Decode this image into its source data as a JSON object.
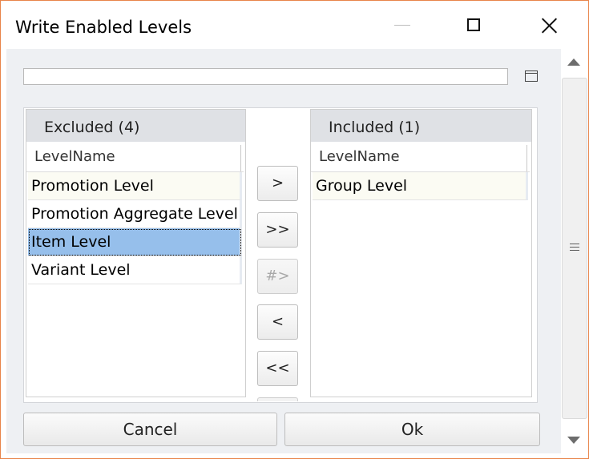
{
  "window": {
    "title": "Write Enabled Levels"
  },
  "search": {
    "value": "",
    "placeholder": ""
  },
  "excluded": {
    "header": "Excluded (4)",
    "column": "LevelName",
    "rows": [
      "Promotion Level",
      "Promotion Aggregate Level",
      "Item Level",
      "Variant Level"
    ],
    "selected_index": 2
  },
  "included": {
    "header": "Included (1)",
    "column": "LevelName",
    "rows": [
      "Group Level"
    ]
  },
  "transfer_buttons": {
    "move_right": ">",
    "move_all_right": ">>",
    "move_hash": "#>",
    "move_left": "<",
    "move_all_left": "<<"
  },
  "footer": {
    "cancel": "Cancel",
    "ok": "Ok"
  },
  "colors": {
    "window_border": "#e8844a",
    "selection": "#96bfeb",
    "header_bg": "#dfe1e5"
  }
}
